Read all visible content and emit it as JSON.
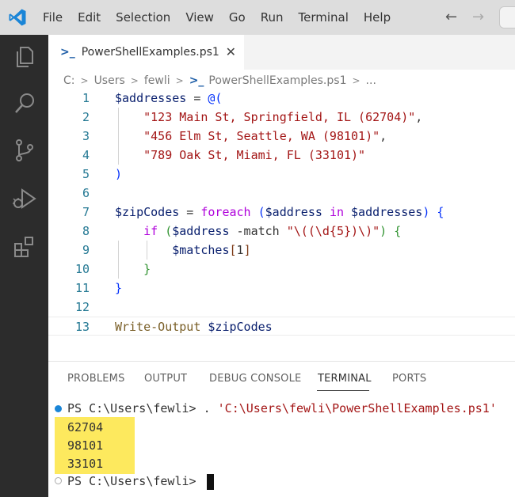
{
  "menu": {
    "items": [
      "File",
      "Edit",
      "Selection",
      "View",
      "Go",
      "Run",
      "Terminal",
      "Help"
    ]
  },
  "nav": {
    "back": "←",
    "forward": "→"
  },
  "activity_icons": [
    "explorer-icon",
    "search-icon",
    "source-control-icon",
    "run-debug-icon",
    "extensions-icon"
  ],
  "tab": {
    "label": "PowerShellExamples.ps1",
    "close": "✕"
  },
  "breadcrumb": {
    "parts": [
      "C:",
      "Users",
      "fewli",
      "PowerShellExamples.ps1",
      "..."
    ]
  },
  "editor": {
    "line_numbers": [
      "1",
      "2",
      "3",
      "4",
      "5",
      "6",
      "7",
      "8",
      "9",
      "10",
      "11",
      "12",
      "13"
    ],
    "lines": [
      [
        {
          "t": "$addresses",
          "c": "var"
        },
        {
          "t": " = ",
          "c": "op"
        },
        {
          "t": "@(",
          "c": "br1"
        }
      ],
      [
        {
          "t": "    ",
          "c": "op"
        },
        {
          "t": "\"123 Main St, Springfield, IL (62704)\"",
          "c": "str"
        },
        {
          "t": ",",
          "c": "op"
        }
      ],
      [
        {
          "t": "    ",
          "c": "op"
        },
        {
          "t": "\"456 Elm St, Seattle, WA (98101)\"",
          "c": "str"
        },
        {
          "t": ",",
          "c": "op"
        }
      ],
      [
        {
          "t": "    ",
          "c": "op"
        },
        {
          "t": "\"789 Oak St, Miami, FL (33101)\"",
          "c": "str"
        }
      ],
      [
        {
          "t": ")",
          "c": "br1"
        }
      ],
      [],
      [
        {
          "t": "$zipCodes",
          "c": "var"
        },
        {
          "t": " = ",
          "c": "op"
        },
        {
          "t": "foreach",
          "c": "kw"
        },
        {
          "t": " ",
          "c": "op"
        },
        {
          "t": "(",
          "c": "br1"
        },
        {
          "t": "$address",
          "c": "var"
        },
        {
          "t": " ",
          "c": "op"
        },
        {
          "t": "in",
          "c": "kw"
        },
        {
          "t": " ",
          "c": "op"
        },
        {
          "t": "$addresses",
          "c": "var"
        },
        {
          "t": ")",
          "c": "br1"
        },
        {
          "t": " ",
          "c": "op"
        },
        {
          "t": "{",
          "c": "br1"
        }
      ],
      [
        {
          "t": "    ",
          "c": "op"
        },
        {
          "t": "if",
          "c": "kw"
        },
        {
          "t": " ",
          "c": "op"
        },
        {
          "t": "(",
          "c": "br2"
        },
        {
          "t": "$address",
          "c": "var"
        },
        {
          "t": " -match ",
          "c": "op"
        },
        {
          "t": "\"\\((\\d{5})\\)\"",
          "c": "str"
        },
        {
          "t": ")",
          "c": "br2"
        },
        {
          "t": " ",
          "c": "op"
        },
        {
          "t": "{",
          "c": "br2"
        }
      ],
      [
        {
          "t": "        ",
          "c": "op"
        },
        {
          "t": "$matches",
          "c": "var"
        },
        {
          "t": "[",
          "c": "br3"
        },
        {
          "t": "1",
          "c": "op"
        },
        {
          "t": "]",
          "c": "br3"
        }
      ],
      [
        {
          "t": "    ",
          "c": "op"
        },
        {
          "t": "}",
          "c": "br2"
        }
      ],
      [
        {
          "t": "}",
          "c": "br1"
        }
      ],
      [],
      [
        {
          "t": "Write-Output",
          "c": "cmd"
        },
        {
          "t": " ",
          "c": "op"
        },
        {
          "t": "$zipCodes",
          "c": "var"
        }
      ]
    ]
  },
  "panel": {
    "tabs": [
      "PROBLEMS",
      "OUTPUT",
      "DEBUG CONSOLE",
      "TERMINAL",
      "PORTS"
    ],
    "active_tab": "TERMINAL"
  },
  "terminal": {
    "prompt1": "PS C:\\Users\\fewli> . ",
    "command_path": "'C:\\Users\\fewli\\PowerShellExamples.ps1'",
    "output": [
      "62704",
      "98101",
      "33101"
    ],
    "prompt2": "PS C:\\Users\\fewli> ",
    "highlight_color": "#fde95e"
  },
  "colors": {
    "activity_bar": "#2c2c2c",
    "title_bar": "#dddddd",
    "accent": "#007acc"
  }
}
